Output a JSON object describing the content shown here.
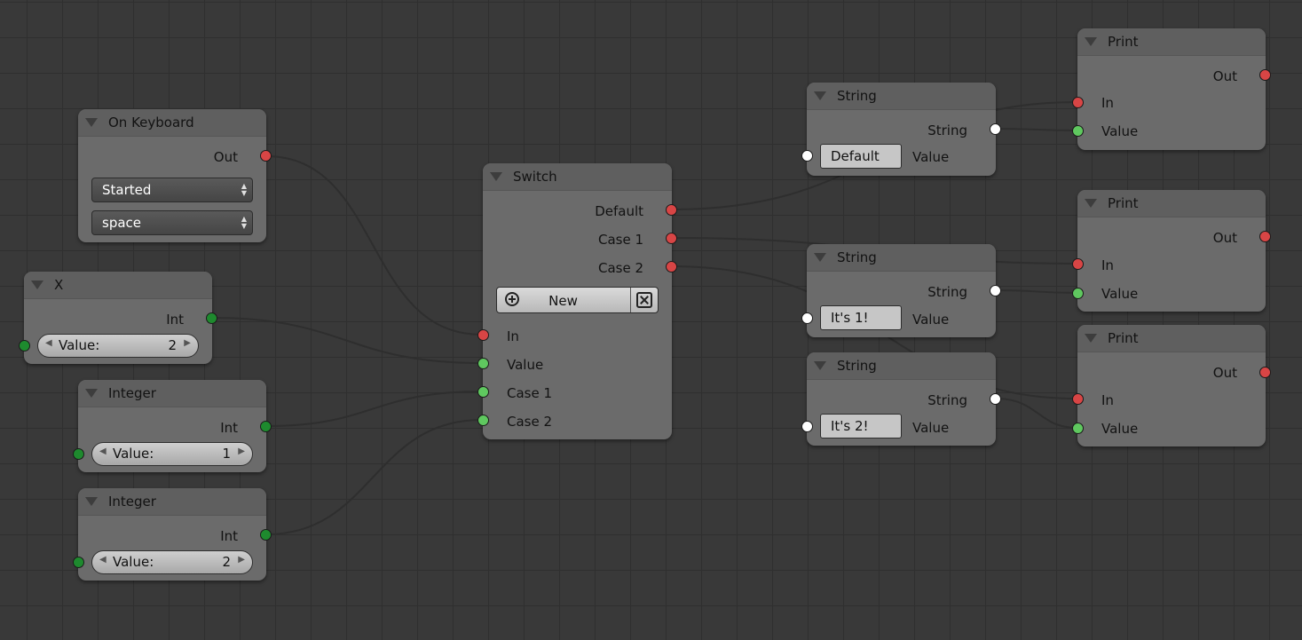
{
  "nodes": {
    "on_keyboard": {
      "title": "On Keyboard",
      "out_label": "Out",
      "event_value": "Started",
      "key_value": "space"
    },
    "x": {
      "title": "X",
      "int_label": "Int",
      "value_label": "Value:",
      "value": "2"
    },
    "integer1": {
      "title": "Integer",
      "int_label": "Int",
      "value_label": "Value:",
      "value": "1"
    },
    "integer2": {
      "title": "Integer",
      "int_label": "Int",
      "value_label": "Value:",
      "value": "2"
    },
    "switch": {
      "title": "Switch",
      "out_default": "Default",
      "out_case1": "Case 1",
      "out_case2": "Case 2",
      "new_label": "New",
      "in_label": "In",
      "value_label": "Value",
      "case1_label": "Case 1",
      "case2_label": "Case 2"
    },
    "string_default": {
      "title": "String",
      "string_label": "String",
      "field_value": "Default",
      "value_label": "Value"
    },
    "string_case1": {
      "title": "String",
      "string_label": "String",
      "field_value": "It's 1!",
      "value_label": "Value"
    },
    "string_case2": {
      "title": "String",
      "string_label": "String",
      "field_value": "It's 2!",
      "value_label": "Value"
    },
    "print1": {
      "title": "Print",
      "out_label": "Out",
      "in_label": "In",
      "value_label": "Value"
    },
    "print2": {
      "title": "Print",
      "out_label": "Out",
      "in_label": "In",
      "value_label": "Value"
    },
    "print3": {
      "title": "Print",
      "out_label": "Out",
      "in_label": "In",
      "value_label": "Value"
    }
  },
  "colors": {
    "background": "#393939",
    "grid": "#2f2f2f",
    "node_body": "#6b6b6b",
    "node_header": "#5f5f5f",
    "socket_execution": "#d84545",
    "socket_value": "#5fc85f",
    "socket_int": "#1e8a2e",
    "socket_string": "#ffffff",
    "link": "#2e2e2e"
  }
}
